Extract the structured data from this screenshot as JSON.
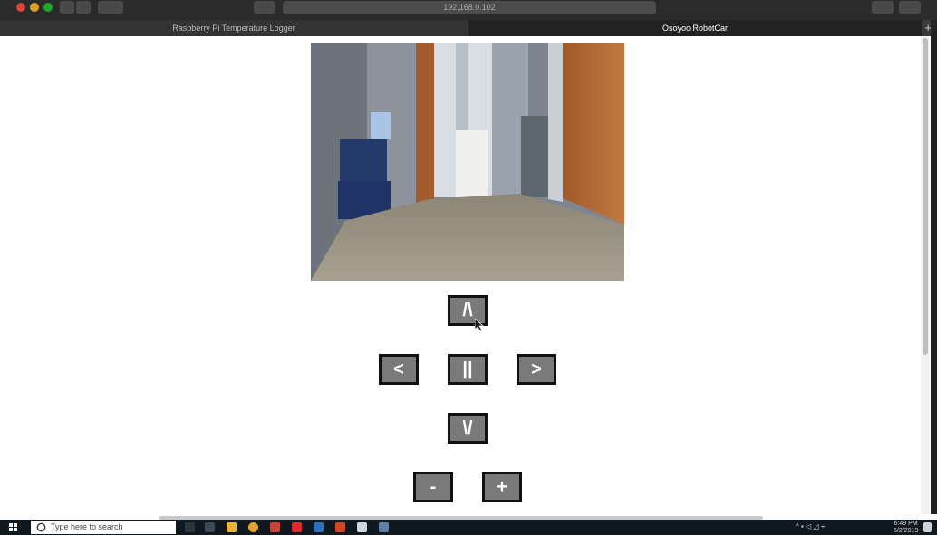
{
  "browser": {
    "url": "192.168.0.102",
    "tabs": [
      {
        "label": "Raspberry Pi Temperature Logger",
        "active": false
      },
      {
        "label": "Osoyoo RobotCar",
        "active": true
      }
    ],
    "new_tab": "+"
  },
  "controls": {
    "forward": "/\\",
    "left": "<",
    "stop": "||",
    "right": ">",
    "backward": "\\/",
    "speed_down": "-",
    "speed_up": "+"
  },
  "taskbar": {
    "search_placeholder": "Type here to search",
    "time": "6:49 PM",
    "date": "5/2/2019"
  },
  "colors": {
    "button_fill": "#7a7a7a",
    "button_border": "#111111",
    "taskbar": "#101820"
  }
}
